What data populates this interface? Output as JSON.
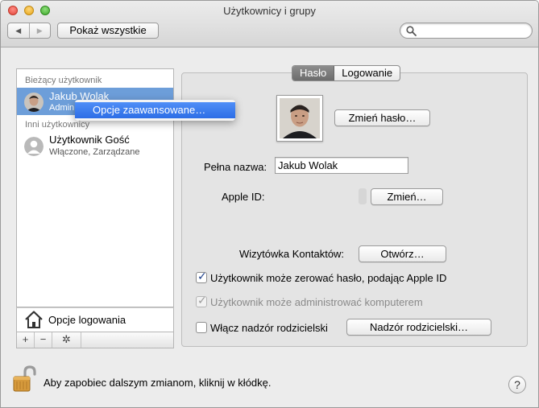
{
  "window": {
    "title": "Użytkownicy i grupy"
  },
  "toolbar": {
    "back_glyph": "◀",
    "forward_glyph": "▶",
    "show_all_label": "Pokaż wszystkie",
    "search_placeholder": ""
  },
  "sidebar": {
    "current_user_header": "Bieżący użytkownik",
    "other_users_header": "Inni użytkownicy",
    "current_user": {
      "name": "Jakub Wolak",
      "role": "Admin"
    },
    "other_users": [
      {
        "name": "Użytkownik Gość",
        "status": "Włączone, Zarządzane"
      }
    ],
    "login_options_label": "Opcje logowania",
    "add_glyph": "+",
    "remove_glyph": "−",
    "action_glyph": "✲"
  },
  "context_menu": {
    "items": [
      "Opcje zaawansowane…"
    ]
  },
  "tabs": [
    {
      "label": "Hasło",
      "active": true
    },
    {
      "label": "Logowanie",
      "active": false
    }
  ],
  "password_tab": {
    "change_password_label": "Zmień hasło…",
    "full_name_label": "Pełna nazwa:",
    "full_name_value": "Jakub Wolak",
    "apple_id_label": "Apple ID:",
    "apple_id_change_label": "Zmień…",
    "contacts_card_label": "Wizytówka Kontaktów:",
    "open_label": "Otwórz…",
    "checkboxes": [
      {
        "label": "Użytkownik może zerować hasło, podając Apple ID",
        "checked": true,
        "enabled": true
      },
      {
        "label": "Użytkownik może administrować komputerem",
        "checked": true,
        "enabled": false
      },
      {
        "label": "Włącz nadzór rodzicielski",
        "checked": false,
        "enabled": true
      }
    ],
    "parental_controls_label": "Nadzór rodzicielski…"
  },
  "footer": {
    "lock_text": "Aby zapobiec dalszym zmianom, kliknij w kłódkę.",
    "help_glyph": "?"
  },
  "colors": {
    "selection": "#6d9ed9",
    "menu_highlight": "#2d6ee6",
    "window_bg": "#ececec"
  },
  "icons": {
    "lock": "lock-icon",
    "house": "house-icon",
    "search": "search-icon",
    "gear": "gear-icon"
  }
}
